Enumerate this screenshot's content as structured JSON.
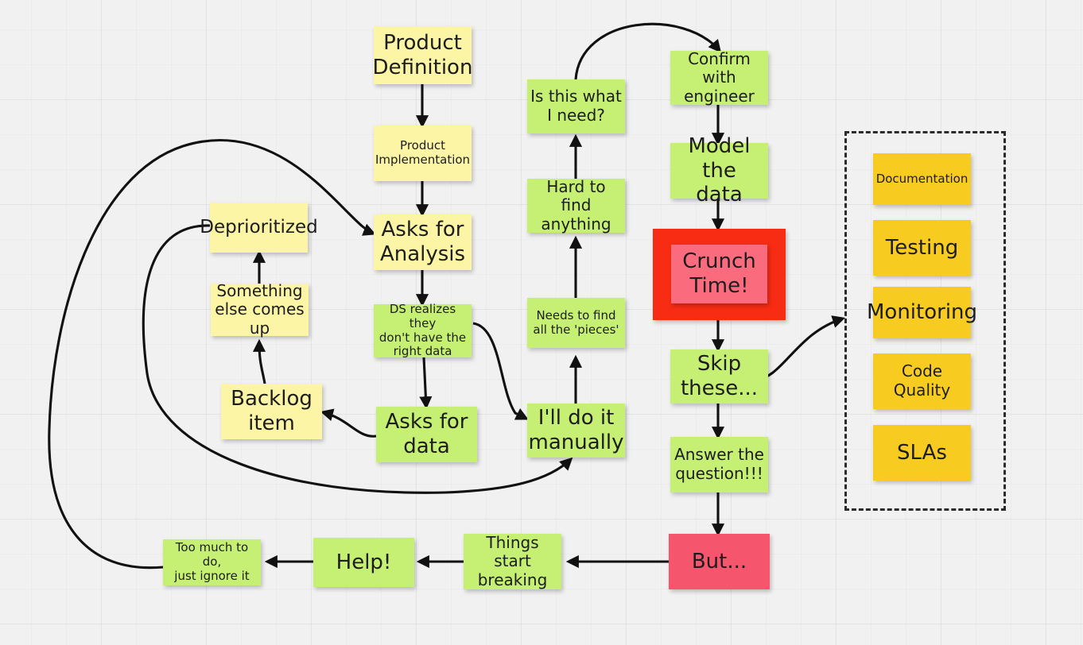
{
  "board": {
    "title": "Data Science Workflow Whiteboard",
    "background_color": "#f1f1f1",
    "grid": "on"
  },
  "colors": {
    "yellow": "#fbf5a5",
    "green": "#c6f073",
    "orange": "#f7cb20",
    "pink": "#fb6b7e",
    "rose": "#f5566e",
    "red_frame": "#f72c13",
    "arrow": "#111111",
    "dashed_border": "#2b2b2b"
  },
  "notes": {
    "product_definition": "Product\nDefinition",
    "product_implementation": "Product\nImplementation",
    "asks_for_analysis": "Asks for\nAnalysis",
    "ds_realizes": "DS realizes they\ndon't have the\nright data",
    "asks_for_data": "Asks for\ndata",
    "deprioritized": "Deprioritized",
    "something_else": "Something\nelse comes up",
    "backlog_item": "Backlog\nitem",
    "is_this_what_i_need": "Is this what\nI need?",
    "hard_to_find": "Hard to find\nanything",
    "needs_to_find_pieces": "Needs to find\nall the 'pieces'",
    "ill_do_it_manually": "I'll do it\nmanually",
    "confirm_with_engineer": "Confirm with\nengineer",
    "model_the_data": "Model the\ndata",
    "crunch_time": "Crunch\nTime!",
    "skip_these": "Skip\nthese...",
    "answer_the_question": "Answer the\nquestion!!!",
    "but": "But...",
    "things_start_breaking": "Things start\nbreaking",
    "help": "Help!",
    "too_much_to_do": "Too much to do,\njust ignore it"
  },
  "skipped_group": {
    "items": [
      "Documentation",
      "Testing",
      "Monitoring",
      "Code\nQuality",
      "SLAs"
    ]
  },
  "flow": {
    "edges": [
      {
        "from": "Product Definition",
        "to": "Product Implementation",
        "style": "straight"
      },
      {
        "from": "Product Implementation",
        "to": "Asks for Analysis",
        "style": "straight"
      },
      {
        "from": "Asks for Analysis",
        "to": "DS realizes they don't have the right data",
        "style": "straight"
      },
      {
        "from": "DS realizes they don't have the right data",
        "to": "Asks for data",
        "style": "straight"
      },
      {
        "from": "DS realizes they don't have the right data",
        "to": "I'll do it manually",
        "style": "curved"
      },
      {
        "from": "Asks for data",
        "to": "Backlog item",
        "style": "curved"
      },
      {
        "from": "Backlog item",
        "to": "Something else comes up",
        "style": "curved"
      },
      {
        "from": "Something else comes up",
        "to": "Deprioritized",
        "style": "straight"
      },
      {
        "from": "Deprioritized",
        "to": "I'll do it manually",
        "style": "curved-loop"
      },
      {
        "from": "I'll do it manually",
        "to": "Needs to find all the 'pieces'",
        "style": "straight"
      },
      {
        "from": "Needs to find all the 'pieces'",
        "to": "Hard to find anything",
        "style": "straight"
      },
      {
        "from": "Hard to find anything",
        "to": "Is this what I need?",
        "style": "straight"
      },
      {
        "from": "Is this what I need?",
        "to": "Confirm with engineer",
        "style": "arc"
      },
      {
        "from": "Confirm with engineer",
        "to": "Model the data",
        "style": "straight"
      },
      {
        "from": "Model the data",
        "to": "Crunch Time!",
        "style": "straight"
      },
      {
        "from": "Crunch Time!",
        "to": "Skip these...",
        "style": "straight"
      },
      {
        "from": "Skip these...",
        "to": "skipped group",
        "style": "curved"
      },
      {
        "from": "Skip these...",
        "to": "Answer the question!!!",
        "style": "straight"
      },
      {
        "from": "Answer the question!!!",
        "to": "But...",
        "style": "straight"
      },
      {
        "from": "But...",
        "to": "Things start breaking",
        "style": "straight"
      },
      {
        "from": "Things start breaking",
        "to": "Help!",
        "style": "straight"
      },
      {
        "from": "Help!",
        "to": "Too much to do, just ignore it",
        "style": "straight"
      },
      {
        "from": "Too much to do, just ignore it",
        "to": "Asks for Analysis",
        "style": "curved-loop"
      }
    ]
  }
}
